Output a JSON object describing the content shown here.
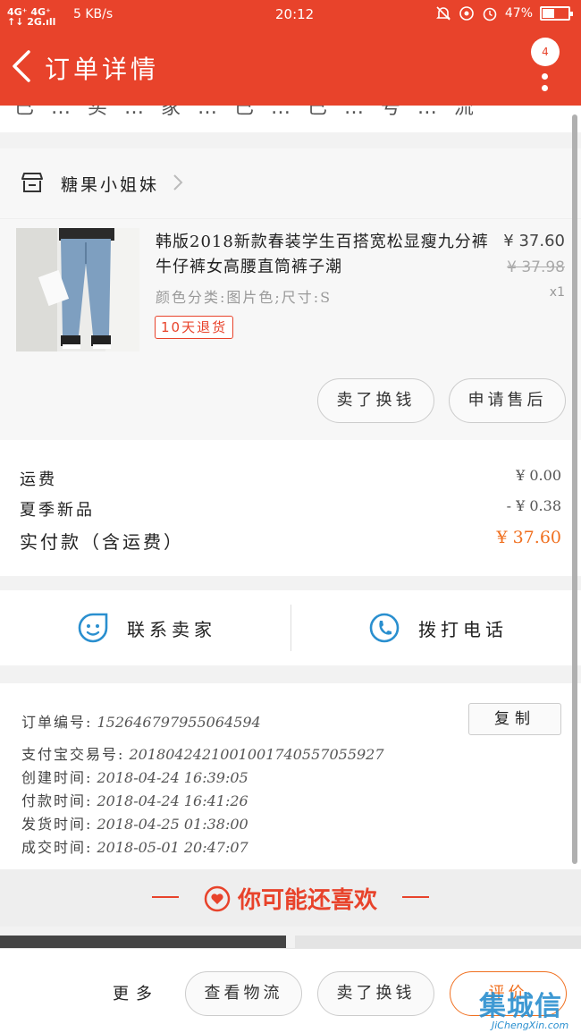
{
  "status_bar": {
    "network_top": "4G⁺ 4G⁺",
    "network_bottom": "↑↓ 2G.ıll",
    "speed": "5 KB/s",
    "time": "20:12",
    "battery": "47%",
    "battery_level": 0.47
  },
  "header": {
    "title": "订单详情",
    "badge_count": "4"
  },
  "cutoff_text": "已 … 买 … 家 … 已 … 已 … 号 … 流",
  "shop": {
    "name": "糖果小姐妹"
  },
  "item": {
    "name": "韩版2018新款春装学生百搭宽松显瘦九分裤牛仔裤女高腰直筒裤子潮",
    "spec": "颜色分类:图片色;尺寸:S",
    "tag": "10天退货",
    "price": "¥ 37.60",
    "original_price": "¥ 37.98",
    "quantity": "x1",
    "refund_button": "卖了换钱",
    "aftersale_button": "申请售后"
  },
  "fees": {
    "shipping_label": "运费",
    "shipping_value": "¥ 0.00",
    "promo_label": "夏季新品",
    "promo_value": "- ¥ 0.38",
    "total_label": "实付款（含运费）",
    "total_value": "¥ 37.60",
    "accent_color": "#f07020"
  },
  "contact": {
    "chat_label": "联系卖家",
    "call_label": "拨打电话",
    "icon_color": "#2a8fcf"
  },
  "order_info": {
    "order_no_label": "订单编号:",
    "order_no": "1526467979550645​94",
    "copy_button": "复制",
    "alipay_label": "支付宝交易号:",
    "alipay_no": "2018042421001001740557055927",
    "created_label": "创建时间:",
    "created": "2018-04-24 16:39:05",
    "paid_label": "付款时间:",
    "paid": "2018-04-24 16:41:26",
    "shipped_label": "发货时间:",
    "shipped": "2018-04-25 01:38:00",
    "done_label": "成交时间:",
    "done": "2018-05-01 20:47:07"
  },
  "recommend": {
    "title": "你可能还喜欢"
  },
  "bottom_bar": {
    "more": "更多",
    "logistics_button": "查看物流",
    "refund_button": "卖了换钱",
    "review_button": "评价"
  },
  "watermark": {
    "brand": "集城信",
    "site": "JiChengXin.com"
  },
  "colors": {
    "brand_red": "#e8432b",
    "price_orange": "#f07020"
  }
}
